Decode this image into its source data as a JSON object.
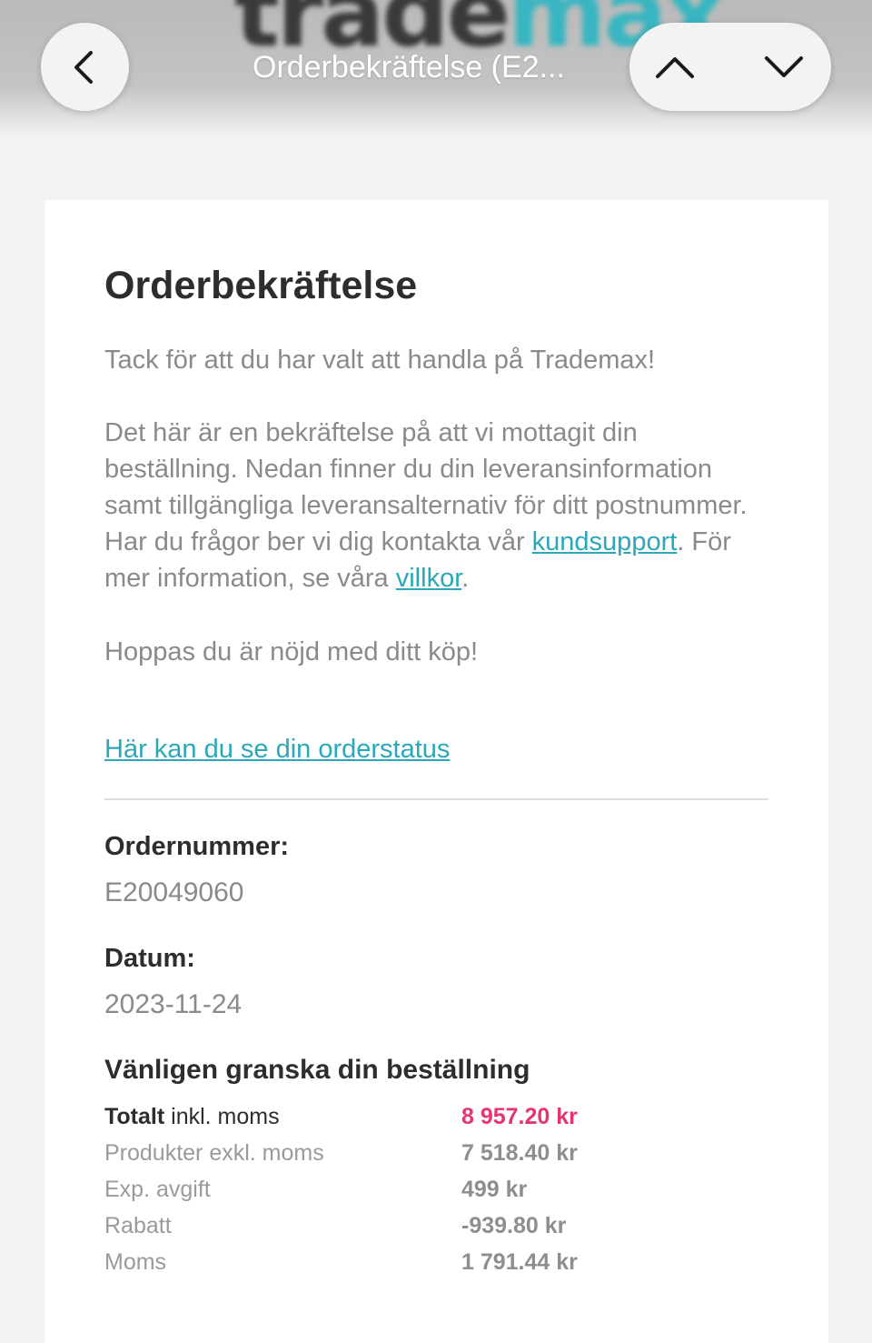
{
  "nav": {
    "title": "Orderbekräftelse (E2...",
    "brand_part1": "trade",
    "brand_part2": "max",
    "back_icon": "chevron-left-icon",
    "prev_icon": "chevron-up-icon",
    "next_icon": "chevron-down-icon"
  },
  "email": {
    "heading": "Orderbekräftelse",
    "thanks": "Tack för att du har valt att handla på Trademax!",
    "body_part1": "Det här är en bekräftelse på att vi mottagit din beställning. Nedan finner du din leveransinformation samt tillgängliga leveransalternativ för ditt postnummer. Har du frågor ber vi dig kontakta vår ",
    "support_link": "kundsupport",
    "body_part2": ". För mer information, se våra ",
    "terms_link": "villkor",
    "body_part3": ".",
    "closing": "Hoppas du är nöjd med ditt köp!",
    "status_link": "Här kan du se din orderstatus",
    "order_label": "Ordernummer:",
    "order_value": "E20049060",
    "date_label": "Datum:",
    "date_value": "2023-11-24",
    "review_heading": "Vänligen granska din beställning",
    "summary": {
      "total_bold": "Totalt",
      "total_rest": " inkl. moms",
      "total_value": "8 957.20 kr",
      "products_label": "Produkter exkl. moms",
      "products_value": "7 518.40 kr",
      "fee_label": "Exp. avgift",
      "fee_value": "499 kr",
      "discount_label": "Rabatt",
      "discount_value": "-939.80 kr",
      "vat_label": "Moms",
      "vat_value": "1 791.44 kr"
    }
  },
  "colors": {
    "accent_link": "#2aa8ba",
    "total_price": "#e5356f",
    "heading": "#2d2d2d",
    "body_text": "#8a8a8a"
  }
}
